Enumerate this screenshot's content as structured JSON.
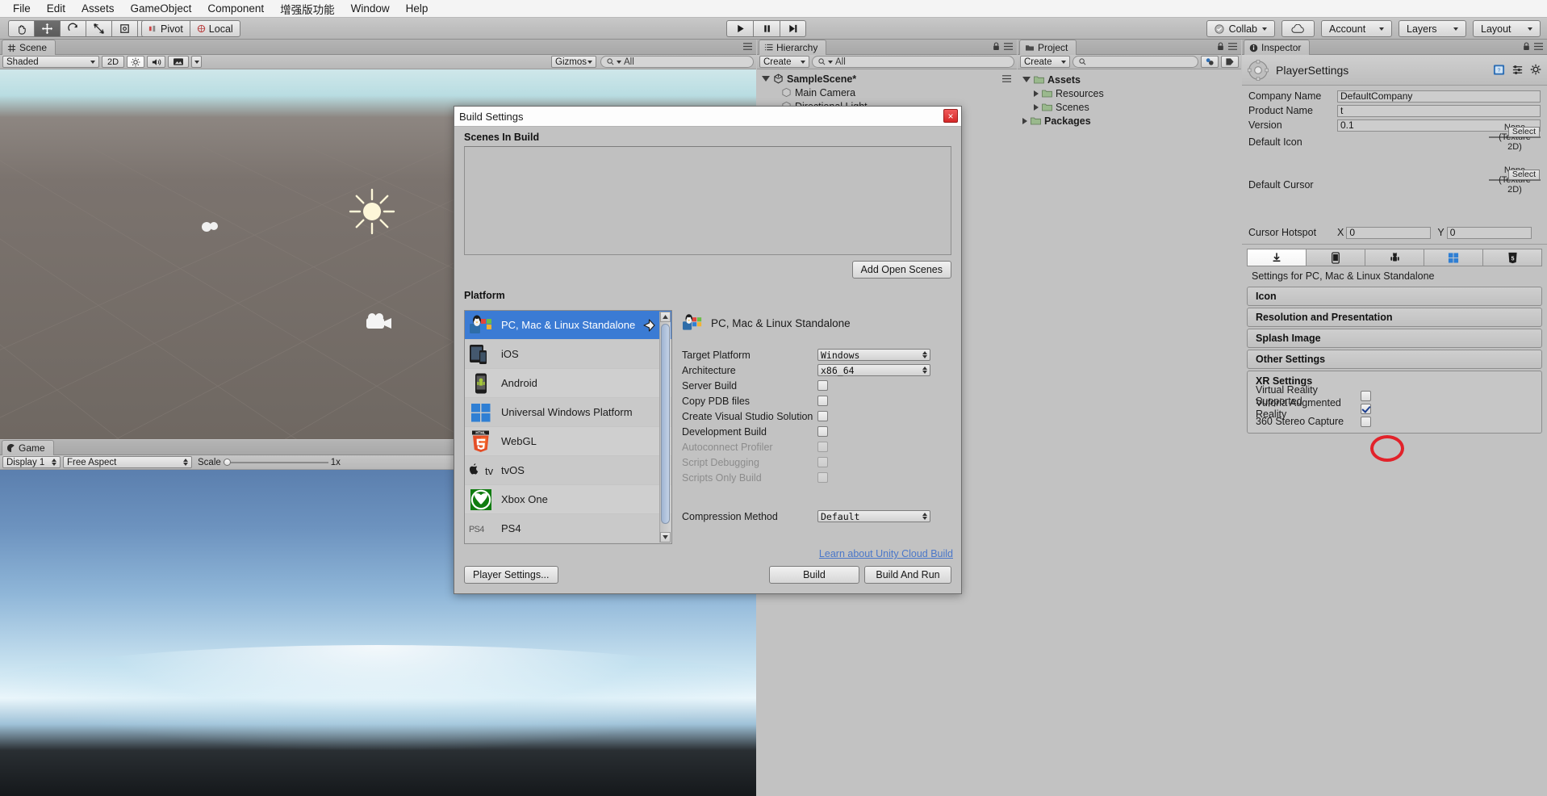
{
  "menubar": {
    "items": [
      "File",
      "Edit",
      "Assets",
      "GameObject",
      "Component",
      "增强版功能",
      "Window",
      "Help"
    ]
  },
  "toolbar": {
    "transform_tools": [
      "hand-tool",
      "move-tool",
      "rotate-tool",
      "scale-tool",
      "rect-tool",
      "transform-tool"
    ],
    "active_tool": "move-tool",
    "pivot_label": "Pivot",
    "space_label": "Local",
    "play_label": "play",
    "pause_label": "pause",
    "step_label": "step",
    "collab_label": "Collab",
    "cloud_label": "cloud",
    "account_label": "Account",
    "layers_label": "Layers",
    "layout_label": "Layout"
  },
  "scene_view": {
    "tab_label": "Scene",
    "shading_mode": "Shaded",
    "mode_2d": "2D",
    "lighting_icon": "sun-icon",
    "audio_icon": "speaker-icon",
    "fx_icon": "image-icon",
    "gizmos_label": "Gizmos",
    "search_placeholder": "All"
  },
  "game_view": {
    "tab_label": "Game",
    "display": "Display 1",
    "aspect": "Free Aspect",
    "scale_label": "Scale",
    "scale_value": "1x"
  },
  "hierarchy": {
    "tab_label": "Hierarchy",
    "create_label": "Create",
    "search_placeholder": "All",
    "scene_name": "SampleScene*",
    "objects": [
      "Main Camera",
      "Directional Light"
    ]
  },
  "project": {
    "tab_label": "Project",
    "create_label": "Create",
    "search_placeholder": "",
    "tree": [
      {
        "label": "Assets",
        "depth": 0,
        "bold": true,
        "expanded": true
      },
      {
        "label": "Resources",
        "depth": 1,
        "bold": false,
        "expanded": false
      },
      {
        "label": "Scenes",
        "depth": 1,
        "bold": false,
        "expanded": false
      },
      {
        "label": "Packages",
        "depth": 0,
        "bold": true,
        "expanded": false
      }
    ]
  },
  "inspector": {
    "tab_label": "Inspector",
    "title": "PlayerSettings",
    "header_icons": [
      "book-icon",
      "preset-icon",
      "gear-icon"
    ],
    "properties": [
      {
        "label": "Company Name",
        "value": "DefaultCompany"
      },
      {
        "label": "Product Name",
        "value": "t"
      },
      {
        "label": "Version",
        "value": "0.1"
      }
    ],
    "default_icon": {
      "label": "Default Icon",
      "value_line1": "None",
      "value_line2": "(Texture",
      "value_line3": "2D)",
      "select_label": "Select"
    },
    "default_cursor": {
      "label": "Default Cursor",
      "value_line1": "None",
      "value_line2": "(Texture",
      "value_line3": "2D)",
      "select_label": "Select"
    },
    "cursor_hotspot": {
      "label": "Cursor Hotspot",
      "x_label": "X",
      "x_value": "0",
      "y_label": "Y",
      "y_value": "0"
    },
    "platform_tabs": [
      {
        "icon": "standalone-icon",
        "selected": true
      },
      {
        "icon": "ios-icon",
        "selected": false
      },
      {
        "icon": "android-icon",
        "selected": false
      },
      {
        "icon": "windows-icon",
        "selected": false
      },
      {
        "icon": "webgl-icon",
        "selected": false
      }
    ],
    "settings_for": "Settings for PC, Mac & Linux Standalone",
    "sections": [
      "Icon",
      "Resolution and Presentation",
      "Splash Image",
      "Other Settings"
    ],
    "xr": {
      "title": "XR Settings",
      "rows": [
        {
          "label": "Virtual Reality Supported",
          "checked": false
        },
        {
          "label": "Vuforia Augmented Reality",
          "checked": true,
          "annotated": true
        },
        {
          "label": "360 Stereo Capture",
          "checked": false
        }
      ]
    }
  },
  "build_settings": {
    "title": "Build Settings",
    "close_label": "×",
    "scenes_in_build_label": "Scenes In Build",
    "add_open_scenes_label": "Add Open Scenes",
    "platform_label": "Platform",
    "platforms": [
      {
        "name": "PC, Mac & Linux Standalone",
        "icon": "standalone-icon",
        "selected": true,
        "unity_badge": true
      },
      {
        "name": "iOS",
        "icon": "ios-icon",
        "selected": false
      },
      {
        "name": "Android",
        "icon": "android-icon",
        "selected": false
      },
      {
        "name": "Universal Windows Platform",
        "icon": "windows-icon",
        "selected": false
      },
      {
        "name": "WebGL",
        "icon": "webgl-icon",
        "selected": false
      },
      {
        "name": "tvOS",
        "icon": "tvos-icon",
        "selected": false
      },
      {
        "name": "Xbox One",
        "icon": "xbox-icon",
        "selected": false
      },
      {
        "name": "PS4",
        "icon": "ps4-icon",
        "selected": false
      }
    ],
    "detail_title": "PC, Mac & Linux Standalone",
    "options": [
      {
        "label": "Target Platform",
        "type": "select",
        "value": "Windows",
        "disabled": false
      },
      {
        "label": "Architecture",
        "type": "select",
        "value": "x86_64",
        "disabled": false
      },
      {
        "label": "Server Build",
        "type": "checkbox",
        "checked": false,
        "disabled": false
      },
      {
        "label": "Copy PDB files",
        "type": "checkbox",
        "checked": false,
        "disabled": false
      },
      {
        "label": "Create Visual Studio Solution",
        "type": "checkbox",
        "checked": false,
        "disabled": false
      },
      {
        "label": "Development Build",
        "type": "checkbox",
        "checked": false,
        "disabled": false
      },
      {
        "label": "Autoconnect Profiler",
        "type": "checkbox",
        "checked": false,
        "disabled": true
      },
      {
        "label": "Script Debugging",
        "type": "checkbox",
        "checked": false,
        "disabled": true
      },
      {
        "label": "Scripts Only Build",
        "type": "checkbox",
        "checked": false,
        "disabled": true
      }
    ],
    "compression": {
      "label": "Compression Method",
      "value": "Default"
    },
    "cloud_link": "Learn about Unity Cloud Build",
    "player_settings_label": "Player Settings...",
    "build_label": "Build",
    "build_and_run_label": "Build And Run"
  },
  "colors": {
    "accent_blue": "#3b7bd4",
    "annotation_red": "#e2222a",
    "link_blue": "#4a77c9",
    "panel_gray": "#c2c2c2"
  }
}
